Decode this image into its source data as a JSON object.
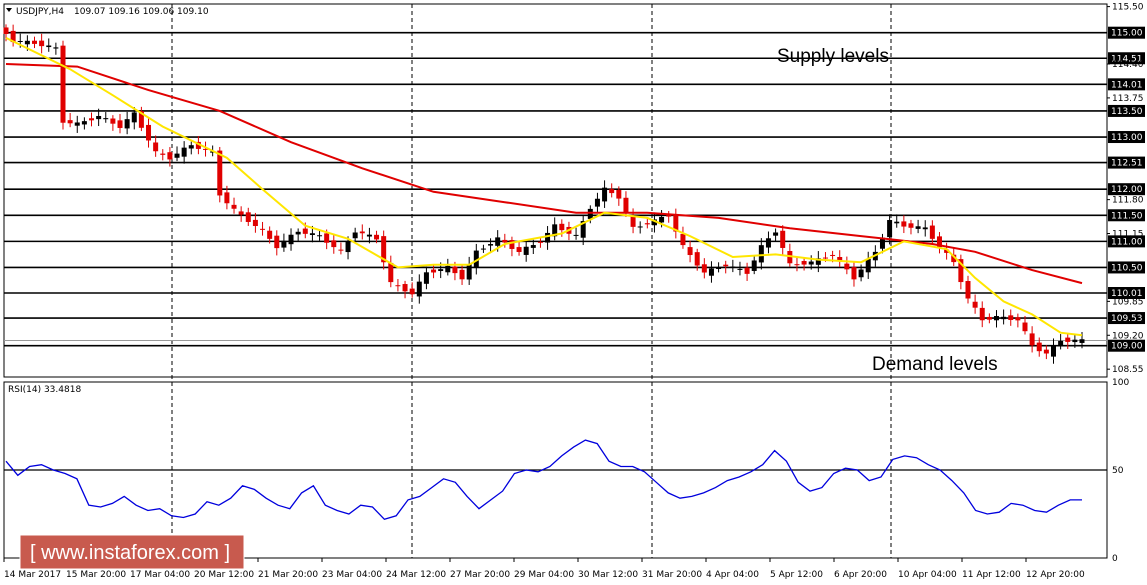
{
  "header": {
    "symbol": "USDJPY,H4",
    "ohlc": "109.07 109.16 109.06 109.10",
    "rsi": "RSI(14) 33.4818"
  },
  "annotations": {
    "supply": "Supply levels",
    "demand": "Demand levels"
  },
  "watermark": "[ www.instaforex.com ]",
  "colors": {
    "bull": "#000000",
    "bear": "#e00000",
    "ma_fast": "#ffe600",
    "ma_slow": "#e00000",
    "rsi": "#0000dd"
  },
  "chart_data": [
    {
      "type": "candlestick",
      "ylim": [
        108.4,
        115.55
      ],
      "x_ticks": [
        "14 Mar 2017",
        "15 Mar 20:00",
        "17 Mar 04:00",
        "20 Mar 12:00",
        "21 Mar 20:00",
        "23 Mar 04:00",
        "24 Mar 12:00",
        "27 Mar 20:00",
        "29 Mar 04:00",
        "30 Mar 12:00",
        "31 Mar 20:00",
        "4 Apr 04:00",
        "5 Apr 12:00",
        "6 Apr 20:00",
        "10 Apr 04:00",
        "11 Apr 12:00",
        "12 Apr 20:00"
      ],
      "y_ticks": [
        "115.50",
        "115.00",
        "114.51",
        "114.40",
        "114.01",
        "113.75",
        "113.50",
        "113.00",
        "112.51",
        "112.00",
        "111.80",
        "111.50",
        "111.15",
        "111.00",
        "110.50",
        "110.01",
        "109.85",
        "109.53",
        "109.20",
        "109.00",
        "108.55"
      ],
      "level_lines": [
        115.0,
        114.51,
        114.01,
        113.5,
        113.0,
        112.51,
        112.0,
        111.5,
        111.0,
        110.5,
        110.01,
        109.53,
        109.0
      ],
      "price_tags": [
        "115.00",
        "114.51",
        "114.01",
        "113.50",
        "113.00",
        "112.51",
        "112.00",
        "111.50",
        "111.00",
        "110.50",
        "110.01",
        "109.53",
        "109.00"
      ],
      "trend": [
        [
          0,
          115.1
        ],
        [
          2,
          114.85
        ],
        [
          5,
          114.8
        ],
        [
          8,
          114.7
        ],
        [
          9,
          113.3
        ],
        [
          11,
          113.25
        ],
        [
          14,
          113.4
        ],
        [
          17,
          113.2
        ],
        [
          19,
          113.45
        ],
        [
          22,
          112.7
        ],
        [
          24,
          112.6
        ],
        [
          27,
          112.85
        ],
        [
          30,
          112.7
        ],
        [
          31,
          111.9
        ],
        [
          33,
          111.6
        ],
        [
          37,
          111.2
        ],
        [
          39,
          110.9
        ],
        [
          42,
          111.2
        ],
        [
          45,
          111.1
        ],
        [
          48,
          110.8
        ],
        [
          50,
          111.2
        ],
        [
          53,
          111.05
        ],
        [
          55,
          110.2
        ],
        [
          58,
          110.0
        ],
        [
          60,
          110.4
        ],
        [
          63,
          110.5
        ],
        [
          65,
          110.3
        ],
        [
          67,
          110.8
        ],
        [
          70,
          111.05
        ],
        [
          73,
          110.8
        ],
        [
          76,
          111.0
        ],
        [
          78,
          111.3
        ],
        [
          81,
          111.1
        ],
        [
          83,
          111.65
        ],
        [
          85,
          112.0
        ],
        [
          87,
          111.85
        ],
        [
          89,
          111.25
        ],
        [
          91,
          111.35
        ],
        [
          94,
          111.5
        ],
        [
          96,
          110.9
        ],
        [
          99,
          110.4
        ],
        [
          102,
          110.55
        ],
        [
          105,
          110.4
        ],
        [
          107,
          110.9
        ],
        [
          109,
          111.2
        ],
        [
          111,
          110.55
        ],
        [
          114,
          110.6
        ],
        [
          117,
          110.75
        ],
        [
          120,
          110.3
        ],
        [
          123,
          110.8
        ],
        [
          125,
          111.4
        ],
        [
          127,
          111.3
        ],
        [
          130,
          111.25
        ],
        [
          132,
          110.9
        ],
        [
          134,
          110.6
        ],
        [
          136,
          109.9
        ],
        [
          138,
          109.5
        ],
        [
          140,
          109.55
        ],
        [
          143,
          109.5
        ],
        [
          145,
          109.0
        ],
        [
          147,
          108.85
        ],
        [
          149,
          109.1
        ],
        [
          151,
          109.1
        ]
      ],
      "ma_fast": [
        [
          0,
          114.9
        ],
        [
          9,
          114.3
        ],
        [
          15,
          113.8
        ],
        [
          22,
          113.2
        ],
        [
          31,
          112.6
        ],
        [
          36,
          112.0
        ],
        [
          42,
          111.3
        ],
        [
          48,
          111.05
        ],
        [
          55,
          110.5
        ],
        [
          60,
          110.55
        ],
        [
          65,
          110.55
        ],
        [
          70,
          110.95
        ],
        [
          78,
          111.15
        ],
        [
          84,
          111.55
        ],
        [
          90,
          111.45
        ],
        [
          96,
          111.1
        ],
        [
          102,
          110.7
        ],
        [
          108,
          110.75
        ],
        [
          114,
          110.65
        ],
        [
          120,
          110.6
        ],
        [
          126,
          111.0
        ],
        [
          132,
          110.85
        ],
        [
          136,
          110.3
        ],
        [
          140,
          109.85
        ],
        [
          144,
          109.6
        ],
        [
          148,
          109.25
        ],
        [
          151,
          109.2
        ]
      ],
      "ma_slow": [
        [
          0,
          114.4
        ],
        [
          10,
          114.35
        ],
        [
          20,
          113.9
        ],
        [
          30,
          113.5
        ],
        [
          40,
          112.9
        ],
        [
          50,
          112.4
        ],
        [
          60,
          111.95
        ],
        [
          70,
          111.75
        ],
        [
          80,
          111.55
        ],
        [
          90,
          111.55
        ],
        [
          100,
          111.45
        ],
        [
          110,
          111.25
        ],
        [
          120,
          111.1
        ],
        [
          130,
          110.95
        ],
        [
          136,
          110.8
        ],
        [
          144,
          110.45
        ],
        [
          151,
          110.2
        ]
      ]
    },
    {
      "type": "line",
      "title": "RSI(14) 33.4818",
      "ylim": [
        0,
        100
      ],
      "y_ticks": [
        "100",
        "50",
        "0"
      ],
      "level_line": 50,
      "series": [
        {
          "values": [
            55,
            47,
            52,
            53,
            50,
            48,
            45,
            30,
            29,
            31,
            35,
            30,
            27,
            28,
            24,
            23,
            25,
            32,
            30,
            34,
            41,
            39,
            34,
            30,
            28,
            37,
            41,
            30,
            27,
            25,
            30,
            29,
            22,
            24,
            33,
            35,
            40,
            45,
            43,
            35,
            28,
            33,
            38,
            48,
            50,
            49,
            52,
            58,
            63,
            67,
            65,
            55,
            52,
            52,
            49,
            43,
            37,
            34,
            35,
            37,
            40,
            44,
            46,
            49,
            53,
            61,
            55,
            43,
            38,
            40,
            48,
            51,
            50,
            44,
            46,
            56,
            58,
            57,
            53,
            50,
            44,
            37,
            27,
            25,
            26,
            31,
            30,
            27,
            26,
            30,
            33,
            33
          ]
        }
      ]
    }
  ]
}
